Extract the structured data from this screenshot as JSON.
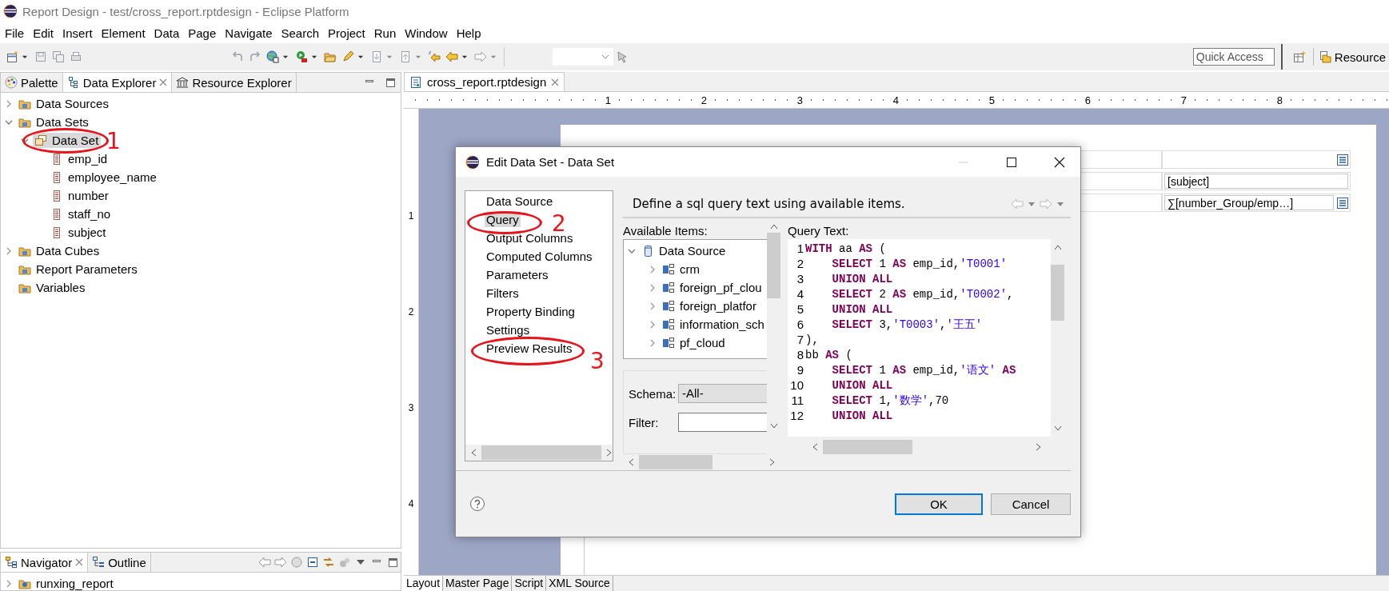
{
  "window": {
    "title": "Report Design - test/cross_report.rptdesign - Eclipse Platform"
  },
  "menu": [
    "File",
    "Edit",
    "Insert",
    "Element",
    "Data",
    "Page",
    "Navigate",
    "Search",
    "Project",
    "Run",
    "Window",
    "Help"
  ],
  "quick_access": {
    "placeholder": "Quick Access"
  },
  "perspective": {
    "label": "Resource"
  },
  "explorer": {
    "tabs": [
      {
        "label": "Palette",
        "selected": false
      },
      {
        "label": "Data Explorer",
        "selected": true
      },
      {
        "label": "Resource Explorer",
        "selected": false
      }
    ],
    "tree": [
      {
        "label": "Data Sources",
        "kind": "folder",
        "expanded": false,
        "selected": false
      },
      {
        "label": "Data Sets",
        "kind": "folder",
        "expanded": true,
        "selected": false,
        "children": [
          {
            "label": "Data Set",
            "kind": "dataset",
            "expanded": true,
            "selected": true,
            "children": [
              {
                "label": "emp_id",
                "kind": "column",
                "selected": false
              },
              {
                "label": "employee_name",
                "kind": "column",
                "selected": false
              },
              {
                "label": "number",
                "kind": "column",
                "selected": false
              },
              {
                "label": "staff_no",
                "kind": "column",
                "selected": false
              },
              {
                "label": "subject",
                "kind": "column",
                "selected": false
              }
            ]
          }
        ]
      },
      {
        "label": "Data Cubes",
        "kind": "folder",
        "expanded": false,
        "selected": false
      },
      {
        "label": "Report Parameters",
        "kind": "folder",
        "selected": false
      },
      {
        "label": "Variables",
        "kind": "folder",
        "selected": false
      }
    ]
  },
  "navigator": {
    "tabs": [
      {
        "label": "Navigator",
        "selected": true
      },
      {
        "label": "Outline",
        "selected": false
      }
    ],
    "tree": [
      {
        "label": "runxing_report",
        "kind": "project",
        "expanded": false,
        "selected": false
      }
    ]
  },
  "editor": {
    "tab": "cross_report.rptdesign",
    "ruler": [
      "1",
      "2",
      "3",
      "4",
      "5",
      "6",
      "7",
      "8"
    ],
    "vruler": [
      "1",
      "2",
      "3",
      "4"
    ],
    "cells": [
      "[subject]",
      "∑[number_Group/emp…]"
    ],
    "bottom_tabs": [
      {
        "label": "Layout",
        "selected": true
      },
      {
        "label": "Master Page",
        "selected": false
      },
      {
        "label": "Script",
        "selected": false
      },
      {
        "label": "XML Source",
        "selected": false
      }
    ]
  },
  "dialog": {
    "title": "Edit Data Set - Data Set",
    "pages": [
      {
        "label": "Data Source",
        "selected": false
      },
      {
        "label": "Query",
        "selected": true
      },
      {
        "label": "Output Columns",
        "selected": false
      },
      {
        "label": "Computed Columns",
        "selected": false
      },
      {
        "label": "Parameters",
        "selected": false
      },
      {
        "label": "Filters",
        "selected": false
      },
      {
        "label": "Property Binding",
        "selected": false
      },
      {
        "label": "Settings",
        "selected": false
      },
      {
        "label": "Preview Results",
        "selected": false
      }
    ],
    "header": "Define a sql query text using available items.",
    "available_label": "Available Items:",
    "available_tree": [
      {
        "label": "Data Source",
        "kind": "datasource",
        "expanded": true,
        "selected": false,
        "children": [
          {
            "label": "crm",
            "kind": "schema",
            "expanded": false,
            "selected": false
          },
          {
            "label": "foreign_pf_clou",
            "kind": "schema",
            "expanded": false,
            "selected": false
          },
          {
            "label": "foreign_platfor",
            "kind": "schema",
            "expanded": false,
            "selected": false
          },
          {
            "label": "information_sch",
            "kind": "schema",
            "expanded": false,
            "selected": false
          },
          {
            "label": "pf_cloud",
            "kind": "schema",
            "expanded": false,
            "selected": false
          }
        ]
      }
    ],
    "schema_label": "Schema:",
    "schema_value": "-All-",
    "filter_label": "Filter:",
    "query_label": "Query Text:",
    "code": [
      {
        "no": "1",
        "indent": false,
        "tokens": [
          {
            "kind": "kw",
            "text": "WITH"
          },
          {
            "kind": "plain",
            "text": " aa "
          },
          {
            "kind": "kw",
            "text": "AS"
          },
          {
            "kind": "plain",
            "text": " ("
          }
        ]
      },
      {
        "no": "2",
        "indent": true,
        "tokens": [
          {
            "kind": "kw",
            "text": "SELECT"
          },
          {
            "kind": "plain",
            "text": " 1 "
          },
          {
            "kind": "kw",
            "text": "AS"
          },
          {
            "kind": "plain",
            "text": " emp_id,"
          },
          {
            "kind": "str",
            "text": "'T0001'"
          }
        ]
      },
      {
        "no": "3",
        "indent": true,
        "tokens": [
          {
            "kind": "kw",
            "text": "UNION ALL"
          }
        ]
      },
      {
        "no": "4",
        "indent": true,
        "tokens": [
          {
            "kind": "kw",
            "text": "SELECT"
          },
          {
            "kind": "plain",
            "text": " 2 "
          },
          {
            "kind": "kw",
            "text": "AS"
          },
          {
            "kind": "plain",
            "text": " emp_id,"
          },
          {
            "kind": "str",
            "text": "'T0002'"
          },
          {
            "kind": "plain",
            "text": ","
          }
        ]
      },
      {
        "no": "5",
        "indent": true,
        "tokens": [
          {
            "kind": "kw",
            "text": "UNION ALL"
          }
        ]
      },
      {
        "no": "6",
        "indent": true,
        "tokens": [
          {
            "kind": "kw",
            "text": "SELECT"
          },
          {
            "kind": "plain",
            "text": " 3,"
          },
          {
            "kind": "str",
            "text": "'T0003'"
          },
          {
            "kind": "plain",
            "text": ","
          },
          {
            "kind": "str",
            "text": "'王五'"
          }
        ]
      },
      {
        "no": "7",
        "indent": false,
        "tokens": [
          {
            "kind": "plain",
            "text": "),"
          }
        ]
      },
      {
        "no": "8",
        "indent": false,
        "tokens": [
          {
            "kind": "plain",
            "text": "bb "
          },
          {
            "kind": "kw",
            "text": "AS"
          },
          {
            "kind": "plain",
            "text": " ("
          }
        ]
      },
      {
        "no": "9",
        "indent": true,
        "tokens": [
          {
            "kind": "kw",
            "text": "SELECT"
          },
          {
            "kind": "plain",
            "text": " 1 "
          },
          {
            "kind": "kw",
            "text": "AS"
          },
          {
            "kind": "plain",
            "text": " emp_id,"
          },
          {
            "kind": "str",
            "text": "'语文'"
          },
          {
            "kind": "kw",
            "text": " AS"
          }
        ]
      },
      {
        "no": "10",
        "indent": true,
        "tokens": [
          {
            "kind": "kw",
            "text": "UNION ALL"
          }
        ]
      },
      {
        "no": "11",
        "indent": true,
        "tokens": [
          {
            "kind": "kw",
            "text": "SELECT"
          },
          {
            "kind": "plain",
            "text": " 1,"
          },
          {
            "kind": "str",
            "text": "'数学'"
          },
          {
            "kind": "plain",
            "text": ",70"
          }
        ]
      },
      {
        "no": "12",
        "indent": true,
        "tokens": [
          {
            "kind": "kw",
            "text": "UNION ALL"
          }
        ]
      }
    ],
    "buttons": [
      {
        "label": "OK",
        "default": true
      },
      {
        "label": "Cancel",
        "default": false
      }
    ]
  },
  "annotations": [
    "1",
    "2",
    "3"
  ]
}
